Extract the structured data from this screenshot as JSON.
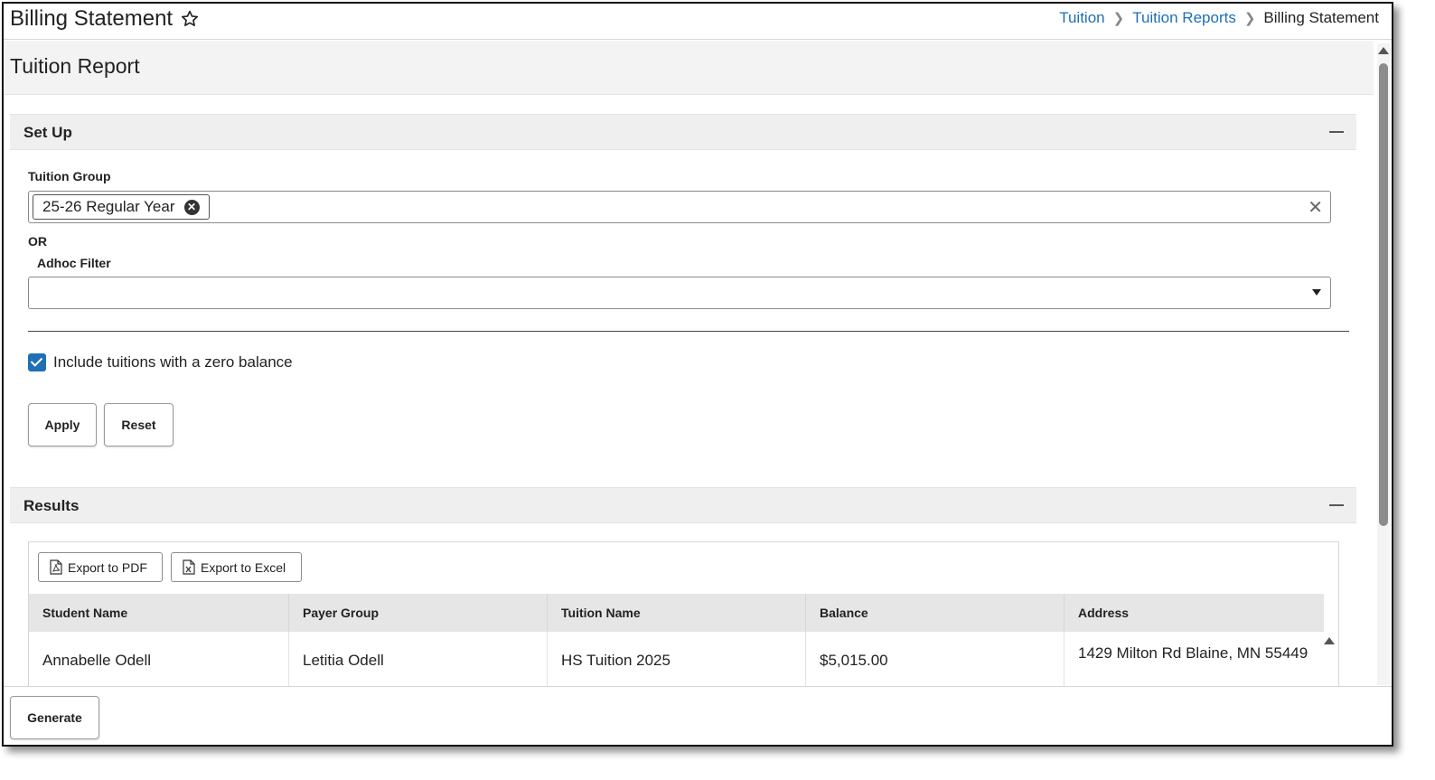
{
  "header": {
    "title": "Billing Statement",
    "breadcrumb": [
      "Tuition",
      "Tuition Reports",
      "Billing Statement"
    ]
  },
  "page_heading": "Tuition Report",
  "setup": {
    "title": "Set Up",
    "tuition_group_label": "Tuition Group",
    "tuition_group_selected": "25-26 Regular Year",
    "or_label": "OR",
    "adhoc_filter_label": "Adhoc Filter",
    "adhoc_filter_value": "",
    "include_zero_balance_label": "Include tuitions with a zero balance",
    "include_zero_balance_checked": true,
    "apply_label": "Apply",
    "reset_label": "Reset"
  },
  "results": {
    "title": "Results",
    "export_pdf_label": "Export to PDF",
    "export_excel_label": "Export to Excel",
    "columns": [
      "Student Name",
      "Payer Group",
      "Tuition Name",
      "Balance",
      "Address"
    ],
    "rows": [
      {
        "student_name": "Annabelle Odell",
        "payer_group": "Letitia Odell",
        "tuition_name": "HS Tuition 2025",
        "balance": "$5,015.00",
        "address": "1429 Milton Rd Blaine, MN 55449"
      }
    ]
  },
  "footer": {
    "generate_label": "Generate"
  },
  "colors": {
    "link": "#1f6fb5",
    "checkbox": "#1f6fb5"
  }
}
